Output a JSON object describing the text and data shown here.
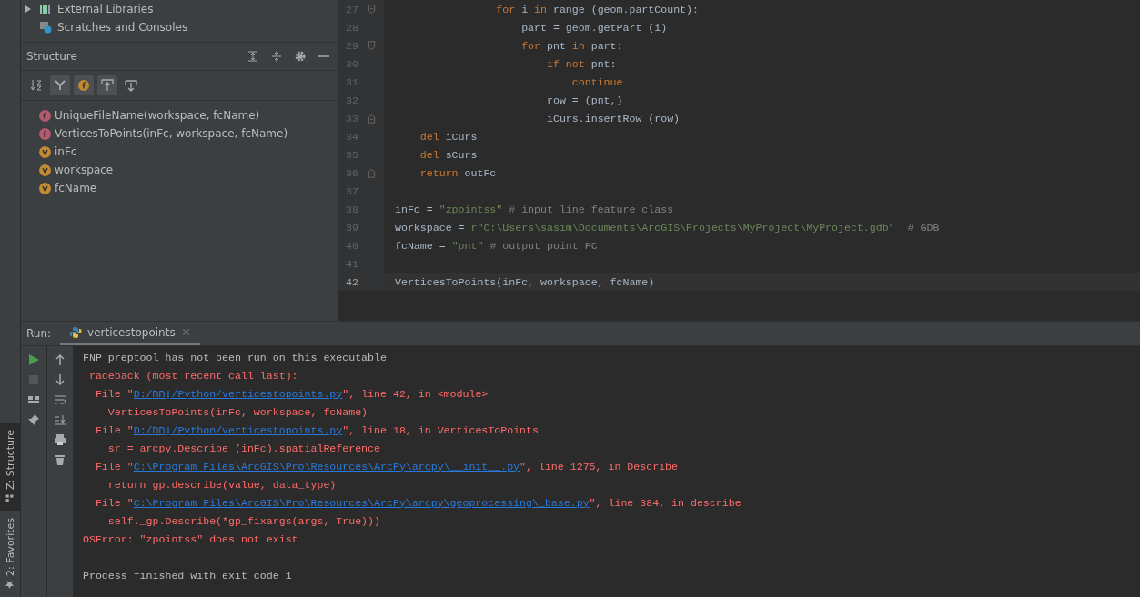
{
  "project_tree": [
    {
      "label": "External Libraries",
      "expanded": false,
      "kind": "library"
    },
    {
      "label": "Scratches and Consoles",
      "kind": "scratch"
    }
  ],
  "structure": {
    "title": "Structure",
    "toolbar": [
      {
        "kind": "sort",
        "on": false
      },
      {
        "kind": "inherited",
        "on": true
      },
      {
        "kind": "fields",
        "on": true
      },
      {
        "kind": "autoscroll-to",
        "on": true
      },
      {
        "kind": "autoscroll-from",
        "on": false
      }
    ],
    "items": [
      {
        "kind": "function",
        "label": "UniqueFileName(workspace, fcName)"
      },
      {
        "kind": "function",
        "label": "VerticesToPoints(inFc, workspace, fcName)"
      },
      {
        "kind": "variable",
        "label": "inFc"
      },
      {
        "kind": "variable",
        "label": "workspace"
      },
      {
        "kind": "variable",
        "label": "fcName"
      }
    ]
  },
  "editor": {
    "lines": [
      {
        "number": "27",
        "fold_marker": {
          "kind": "start"
        },
        "current": false,
        "tokens": [
          {
            "kind": "keyword",
            "text": "                for"
          },
          {
            "kind": "text",
            "text": " i "
          },
          {
            "kind": "keyword",
            "text": "in"
          },
          {
            "kind": "text",
            "text": " range (geom.partCount):"
          }
        ]
      },
      {
        "number": "28",
        "current": false,
        "tokens": [
          {
            "kind": "text",
            "text": "                    part = geom.getPart (i)"
          }
        ]
      },
      {
        "number": "29",
        "fold_marker": {
          "kind": "start"
        },
        "current": false,
        "tokens": [
          {
            "kind": "keyword",
            "text": "                    for"
          },
          {
            "kind": "text",
            "text": " pnt "
          },
          {
            "kind": "keyword",
            "text": "in"
          },
          {
            "kind": "text",
            "text": " part:"
          }
        ]
      },
      {
        "number": "30",
        "current": false,
        "tokens": [
          {
            "kind": "keyword",
            "text": "                        if not"
          },
          {
            "kind": "text",
            "text": " pnt:"
          }
        ]
      },
      {
        "number": "31",
        "current": false,
        "tokens": [
          {
            "kind": "keyword",
            "text": "                            continue"
          }
        ]
      },
      {
        "number": "32",
        "current": false,
        "tokens": [
          {
            "kind": "text",
            "text": "                        row = (pnt,)"
          }
        ]
      },
      {
        "number": "33",
        "fold_marker": {
          "kind": "end"
        },
        "current": false,
        "tokens": [
          {
            "kind": "text",
            "text": "                        iCurs.insertRow (row)"
          }
        ]
      },
      {
        "number": "34",
        "current": false,
        "tokens": [
          {
            "kind": "keyword",
            "text": "    del"
          },
          {
            "kind": "text",
            "text": " iCurs"
          }
        ]
      },
      {
        "number": "35",
        "current": false,
        "tokens": [
          {
            "kind": "keyword",
            "text": "    del"
          },
          {
            "kind": "text",
            "text": " sCurs"
          }
        ]
      },
      {
        "number": "36",
        "fold_marker": {
          "kind": "end"
        },
        "current": false,
        "tokens": [
          {
            "kind": "keyword",
            "text": "    return"
          },
          {
            "kind": "text",
            "text": " outFc"
          }
        ]
      },
      {
        "number": "37",
        "current": false
      },
      {
        "number": "38",
        "current": false,
        "tokens": [
          {
            "kind": "text",
            "text": "inFc = "
          },
          {
            "kind": "string",
            "text": "\"zpointss\""
          },
          {
            "kind": "comment",
            "text": " # input line feature class"
          }
        ]
      },
      {
        "number": "39",
        "current": false,
        "tokens": [
          {
            "kind": "text",
            "text": "workspace = "
          },
          {
            "kind": "string",
            "text": "r\"C:\\Users\\sasim\\Documents\\ArcGIS\\Projects\\MyProject\\MyProject.gdb\""
          },
          {
            "kind": "comment",
            "text": "  # GDB"
          }
        ]
      },
      {
        "number": "40",
        "current": false,
        "tokens": [
          {
            "kind": "text",
            "text": "fcName = "
          },
          {
            "kind": "string",
            "text": "\"pnt\""
          },
          {
            "kind": "comment",
            "text": " # output point FC"
          }
        ]
      },
      {
        "number": "41",
        "current": false
      },
      {
        "number": "42",
        "current": true,
        "tokens": [
          {
            "kind": "text",
            "text": "VerticesToPoints(inFc, workspace, fcName)"
          }
        ]
      }
    ]
  },
  "run": {
    "label": "Run:",
    "tabs": [
      {
        "label": "verticestopoints",
        "selected": true
      }
    ],
    "console": [
      {
        "segments": [
          {
            "kind": "output",
            "text": "FNP preptool has not been run on this executable"
          }
        ]
      },
      {
        "segments": [
          {
            "kind": "error",
            "text": "Traceback (most recent call last):"
          }
        ]
      },
      {
        "segments": [
          {
            "kind": "error",
            "text": "  File \""
          },
          {
            "kind": "link",
            "text": "D:/ןחח/Python/verticestopoints.py"
          },
          {
            "kind": "error",
            "text": "\", line 42, in <module>"
          }
        ]
      },
      {
        "segments": [
          {
            "kind": "error",
            "text": "    VerticesToPoints(inFc, workspace, fcName)"
          }
        ]
      },
      {
        "segments": [
          {
            "kind": "error",
            "text": "  File \""
          },
          {
            "kind": "link",
            "text": "D:/ןחח/Python/verticestopoints.py"
          },
          {
            "kind": "error",
            "text": "\", line 18, in VerticesToPoints"
          }
        ]
      },
      {
        "segments": [
          {
            "kind": "error",
            "text": "    sr = arcpy.Describe (inFc).spatialReference"
          }
        ]
      },
      {
        "segments": [
          {
            "kind": "error",
            "text": "  File \""
          },
          {
            "kind": "link",
            "text": "C:\\Program Files\\ArcGIS\\Pro\\Resources\\ArcPy\\arcpy\\__init__.py"
          },
          {
            "kind": "error",
            "text": "\", line 1275, in Describe"
          }
        ]
      },
      {
        "segments": [
          {
            "kind": "error",
            "text": "    return gp.describe(value, data_type)"
          }
        ]
      },
      {
        "segments": [
          {
            "kind": "error",
            "text": "  File \""
          },
          {
            "kind": "link",
            "text": "C:\\Program Files\\ArcGIS\\Pro\\Resources\\ArcPy\\arcpy\\geoprocessing\\_base.py"
          },
          {
            "kind": "error",
            "text": "\", line 384, in describe"
          }
        ]
      },
      {
        "segments": [
          {
            "kind": "error",
            "text": "    self._gp.Describe(*gp_fixargs(args, True)))"
          }
        ]
      },
      {
        "segments": [
          {
            "kind": "error",
            "text": "OSError: \"zpointss\" does not exist"
          }
        ]
      },
      {
        "kind": "exit-status",
        "segments": [
          {
            "kind": "output",
            "text": "Process finished with exit code 1"
          }
        ]
      }
    ]
  },
  "side_tabs": [
    {
      "label": "Z: Structure",
      "kind": "structure",
      "selected": true
    },
    {
      "label": "2: Favorites",
      "kind": "favorites",
      "selected": false
    }
  ]
}
